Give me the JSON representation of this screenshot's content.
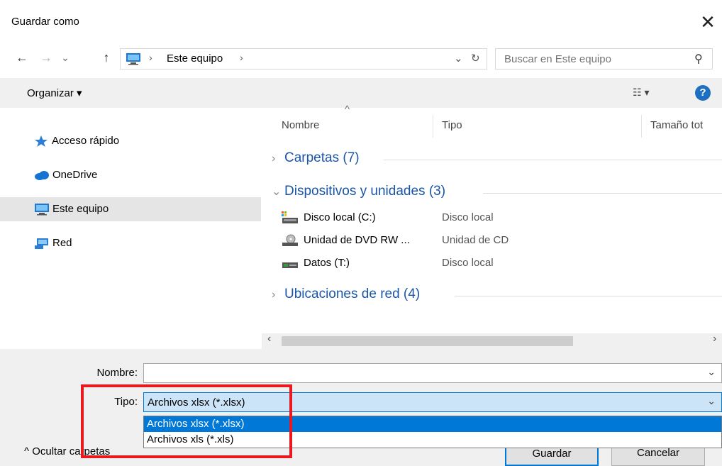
{
  "window": {
    "title": "Guardar como",
    "close_glyph": "✕"
  },
  "address_bar": {
    "back_glyph": "←",
    "forward_glyph": "→",
    "recent_glyph": "⌄",
    "up_glyph": "↑",
    "location": "Este equipo",
    "sep": "›",
    "dropdown_glyph": "⌄",
    "refresh_glyph": "↻",
    "search_placeholder": "Buscar en Este equipo",
    "search_glyph": "⚲"
  },
  "toolbar": {
    "organize_label": "Organizar ▾",
    "view_glyph": "☷ ▾",
    "help_label": "?"
  },
  "sidebar": {
    "items": [
      {
        "label": "Acceso rápido",
        "icon": "star-icon"
      },
      {
        "label": "OneDrive",
        "icon": "cloud-icon"
      },
      {
        "label": "Este equipo",
        "icon": "computer-icon",
        "selected": true
      },
      {
        "label": "Red",
        "icon": "network-icon"
      }
    ]
  },
  "columns": {
    "name": "Nombre",
    "type": "Tipo",
    "size": "Tamaño tot",
    "sort_glyph": "^"
  },
  "groups": [
    {
      "label": "Carpetas (7)",
      "chev": "›"
    },
    {
      "label": "Dispositivos y unidades (3)",
      "chev": "⌄"
    },
    {
      "label": "Ubicaciones de red (4)",
      "chev": "›"
    }
  ],
  "devices": [
    {
      "name": "Disco local (C:)",
      "type": "Disco local",
      "icon": "drive-icon"
    },
    {
      "name": "Unidad de DVD RW ...",
      "type": "Unidad de CD",
      "icon": "dvd-icon"
    },
    {
      "name": "Datos (T:)",
      "type": "Disco local",
      "icon": "network-drive-icon"
    }
  ],
  "scroll": {
    "left_glyph": "‹",
    "right_glyph": "›"
  },
  "form": {
    "name_label": "Nombre:",
    "name_value": "",
    "type_label": "Tipo:",
    "type_value": "Archivos xlsx (*.xlsx)",
    "dd_glyph": "⌄",
    "type_options": [
      "Archivos xlsx (*.xlsx)",
      "Archivos xls (*.xls)"
    ]
  },
  "footer": {
    "hide_label": "^  Ocultar carpetas",
    "save_label": "Guardar",
    "cancel_label": "Cancelar"
  },
  "colors": {
    "accent": "#0078d7",
    "highlight_box": "#e8191f",
    "link_blue": "#1a55a8"
  }
}
